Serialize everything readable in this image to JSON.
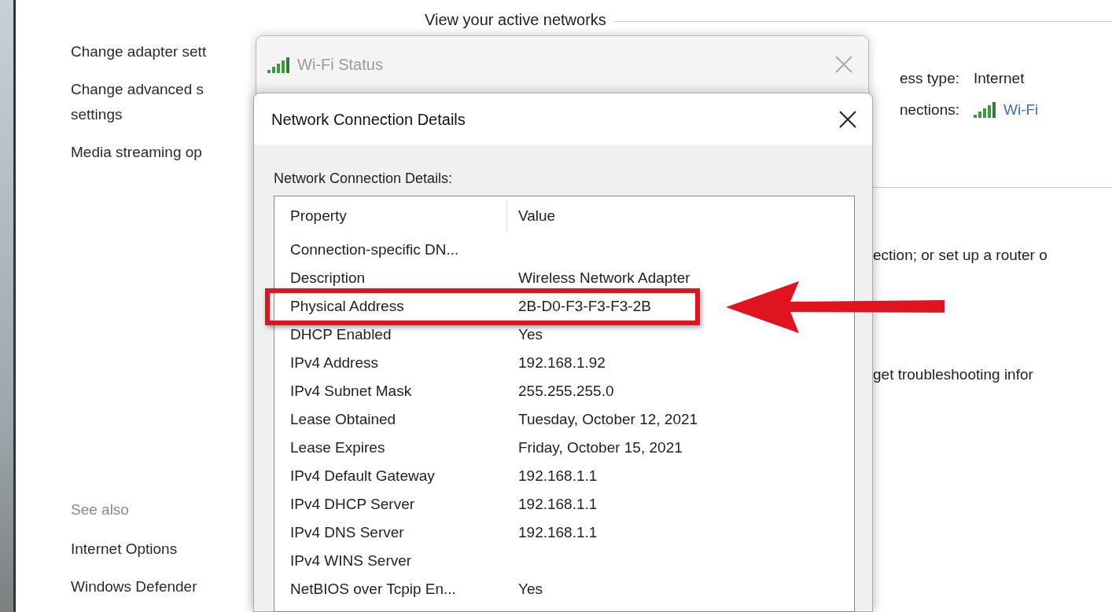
{
  "main_window": {
    "heading": "View your active networks",
    "tasks": [
      {
        "lines": [
          "Change adapter sett"
        ]
      },
      {
        "lines": [
          "Change advanced s",
          "settings"
        ]
      },
      {
        "lines": [
          "Media streaming op"
        ]
      }
    ],
    "see_also": {
      "heading": "See also",
      "links": [
        "Internet Options",
        "Windows Defender"
      ]
    },
    "network_rows": [
      {
        "label": "ess type:",
        "value": "Internet",
        "kind": "text"
      },
      {
        "label": "nections:",
        "value": "Wi-Fi",
        "kind": "link"
      }
    ],
    "texts": [
      "ection; or set up a router o",
      "get troubleshooting infor"
    ]
  },
  "wifi_status_dialog": {
    "title": "Wi-Fi Status"
  },
  "details_dialog": {
    "title": "Network Connection Details",
    "label": "Network Connection Details:",
    "columns": [
      "Property",
      "Value"
    ],
    "rows": [
      {
        "property": "Connection-specific DN...",
        "highlighted": false
      },
      {
        "property": "Description",
        "value": "Wireless Network Adapter",
        "highlighted": false
      },
      {
        "property": "Physical Address",
        "value": "2B-D0-F3-F3-F3-2B",
        "highlighted": true
      },
      {
        "property": "DHCP Enabled",
        "value": "Yes",
        "highlighted": false
      },
      {
        "property": "IPv4 Address",
        "value": "192.168.1.92",
        "highlighted": false
      },
      {
        "property": "IPv4 Subnet Mask",
        "value": "255.255.255.0",
        "highlighted": false
      },
      {
        "property": "Lease Obtained",
        "value": "Tuesday, October 12, 2021",
        "highlighted": false
      },
      {
        "property": "Lease Expires",
        "value": "Friday, October 15, 2021",
        "highlighted": false
      },
      {
        "property": "IPv4 Default Gateway",
        "value": "192.168.1.1",
        "highlighted": false
      },
      {
        "property": "IPv4 DHCP Server",
        "value": "192.168.1.1",
        "highlighted": false
      },
      {
        "property": "IPv4 DNS Server",
        "value": "192.168.1.1",
        "highlighted": false
      },
      {
        "property": "IPv4 WINS Server",
        "highlighted": false
      },
      {
        "property": "NetBIOS over Tcpip En...",
        "value": "Yes",
        "highlighted": false
      }
    ]
  }
}
